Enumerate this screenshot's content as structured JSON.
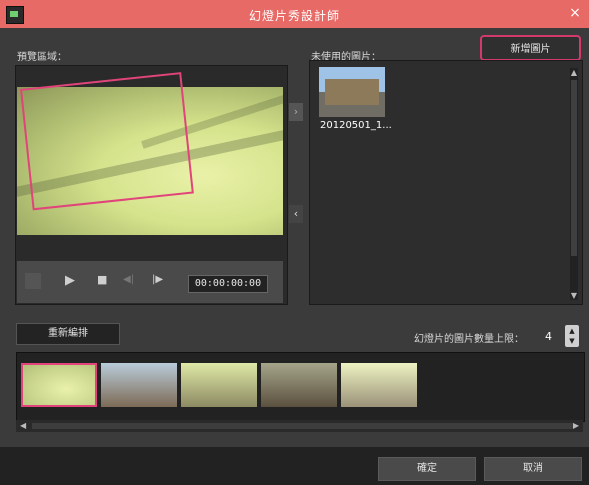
{
  "window": {
    "title": "幻燈片秀設計師",
    "close_glyph": "×"
  },
  "preview": {
    "label": "預覽區域：",
    "timecode": "00:00:00:00"
  },
  "controls": {
    "play_glyph": "▶",
    "stop_glyph": "■",
    "prev_glyph": "◀|",
    "next_glyph": "|▶"
  },
  "unused": {
    "label": "未使用的圖片：",
    "items": [
      {
        "caption": "20120501_1..."
      }
    ]
  },
  "buttons": {
    "new_image": "新增圖片",
    "rearrange": "重新編排",
    "ok": "確定",
    "cancel": "取消"
  },
  "limit": {
    "label": "幻燈片的圖片數量上限：",
    "value": "4"
  },
  "arrows": {
    "right": "›",
    "left": "‹"
  },
  "colors": {
    "title_bar": "#e86a66",
    "highlight": "#e0447a"
  }
}
